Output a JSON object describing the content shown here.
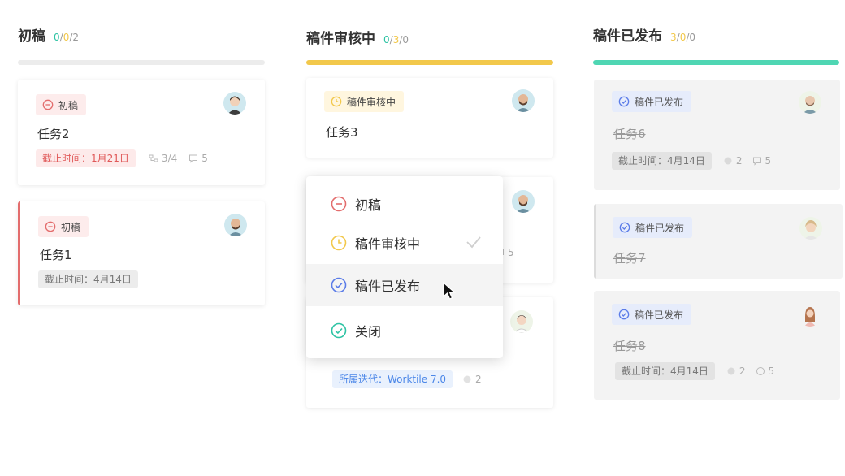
{
  "colors": {
    "draft": "#e36d6d",
    "review": "#f2c84b",
    "done_status": "#5b7ce8",
    "published_bar": "#4fd6b3",
    "closed": "#2ec3a4"
  },
  "columns": [
    {
      "title": "初稿",
      "count_a": "0",
      "count_b": "0",
      "count_c": "2",
      "bar_color": "#ececec",
      "cards": [
        {
          "status": "初稿",
          "title": "任务2",
          "due": "截止时间：1月21日",
          "subtasks": "3/4",
          "comments": "5"
        },
        {
          "status": "初稿",
          "title": "任务1",
          "due": "截止时间：4月14日"
        }
      ]
    },
    {
      "title": "稿件审核中",
      "count_a": "0",
      "count_b": "3",
      "count_c": "0",
      "bar_color": "#f2c84b",
      "cards": [
        {
          "status": "稿件审核中",
          "title": "任务3"
        },
        {
          "comments": "5"
        },
        {
          "iteration": "所属迭代：Worktile 7.0",
          "comments": "2"
        }
      ]
    },
    {
      "title": "稿件已发布",
      "count_a": "3",
      "count_b": "0",
      "count_c": "0",
      "bar_color": "#4fd6b3",
      "cards": [
        {
          "status": "稿件已发布",
          "title": "任务6",
          "due": "截止时间：4月14日",
          "attachments": "2",
          "comments": "5"
        },
        {
          "status": "稿件已发布",
          "title": "任务7"
        },
        {
          "status": "稿件已发布",
          "title": "任务8",
          "due": "截止时间：4月14日",
          "attachments": "2",
          "comments": "5"
        }
      ]
    }
  ],
  "dropdown": {
    "items": [
      {
        "label": "初稿",
        "icon": "minus-circle-icon"
      },
      {
        "label": "稿件审核中",
        "icon": "clock-circle-icon",
        "selected": true
      },
      {
        "label": "稿件已发布",
        "icon": "check-circle-icon",
        "hovered": true
      },
      {
        "label": "关闭",
        "icon": "check-circle-icon"
      }
    ]
  }
}
